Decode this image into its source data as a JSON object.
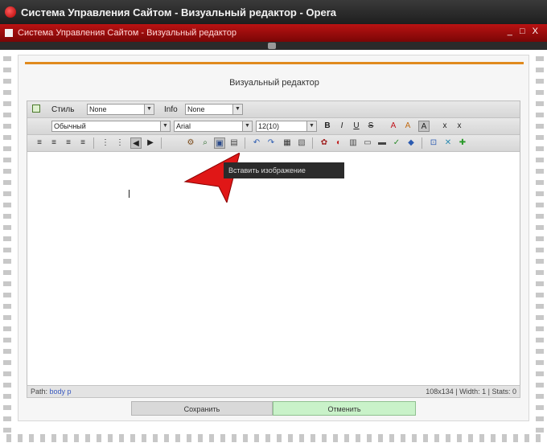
{
  "window": {
    "title": "Система Управления Сайтом - Визуальный редактор - Opera"
  },
  "tab": {
    "title": "Система Управления Сайтом - Визуальный редактор",
    "controls": "_ □ X"
  },
  "dialog": {
    "title": "Визуальный редактор"
  },
  "toolbar": {
    "row1": {
      "style_label": "Стиль",
      "style_value": "None",
      "format_label": "Info",
      "format_value": "None"
    },
    "row2": {
      "font_value": "Обычный",
      "font_name_value": "Arial",
      "font_size_value": "12(10)",
      "buttons": [
        "B",
        "I",
        "U",
        "S",
        "A",
        "A",
        "A",
        "x",
        "x"
      ]
    },
    "row3": {
      "align_buttons": [
        "≡",
        "≡",
        "≡",
        "≡"
      ],
      "list_buttons": [
        "⋮",
        "⋮",
        "◀",
        "▶"
      ],
      "insert_buttons": [
        "⚙",
        "⌕",
        "▣",
        "▤",
        "↶",
        "↷",
        "▦",
        "▧",
        "✿",
        "◐",
        "▥",
        "▭",
        "▬",
        "✓",
        "◆",
        "⊡",
        "✕",
        "✚"
      ]
    }
  },
  "tooltip": {
    "text": "Вставить изображение"
  },
  "status_bar": {
    "left_label": "Path",
    "left_path": "body p",
    "right": "108x134 | Width: 1 | Stats: 0"
  },
  "buttons": {
    "save": "Сохранить",
    "cancel": "Отменить"
  },
  "colors": {
    "title_bar": "#1e1e1e",
    "tab_strip": "#9a0c0c",
    "accent_line": "#e08a1e",
    "cancel_button": "#c9f2c9",
    "arrow": "#e01717"
  }
}
